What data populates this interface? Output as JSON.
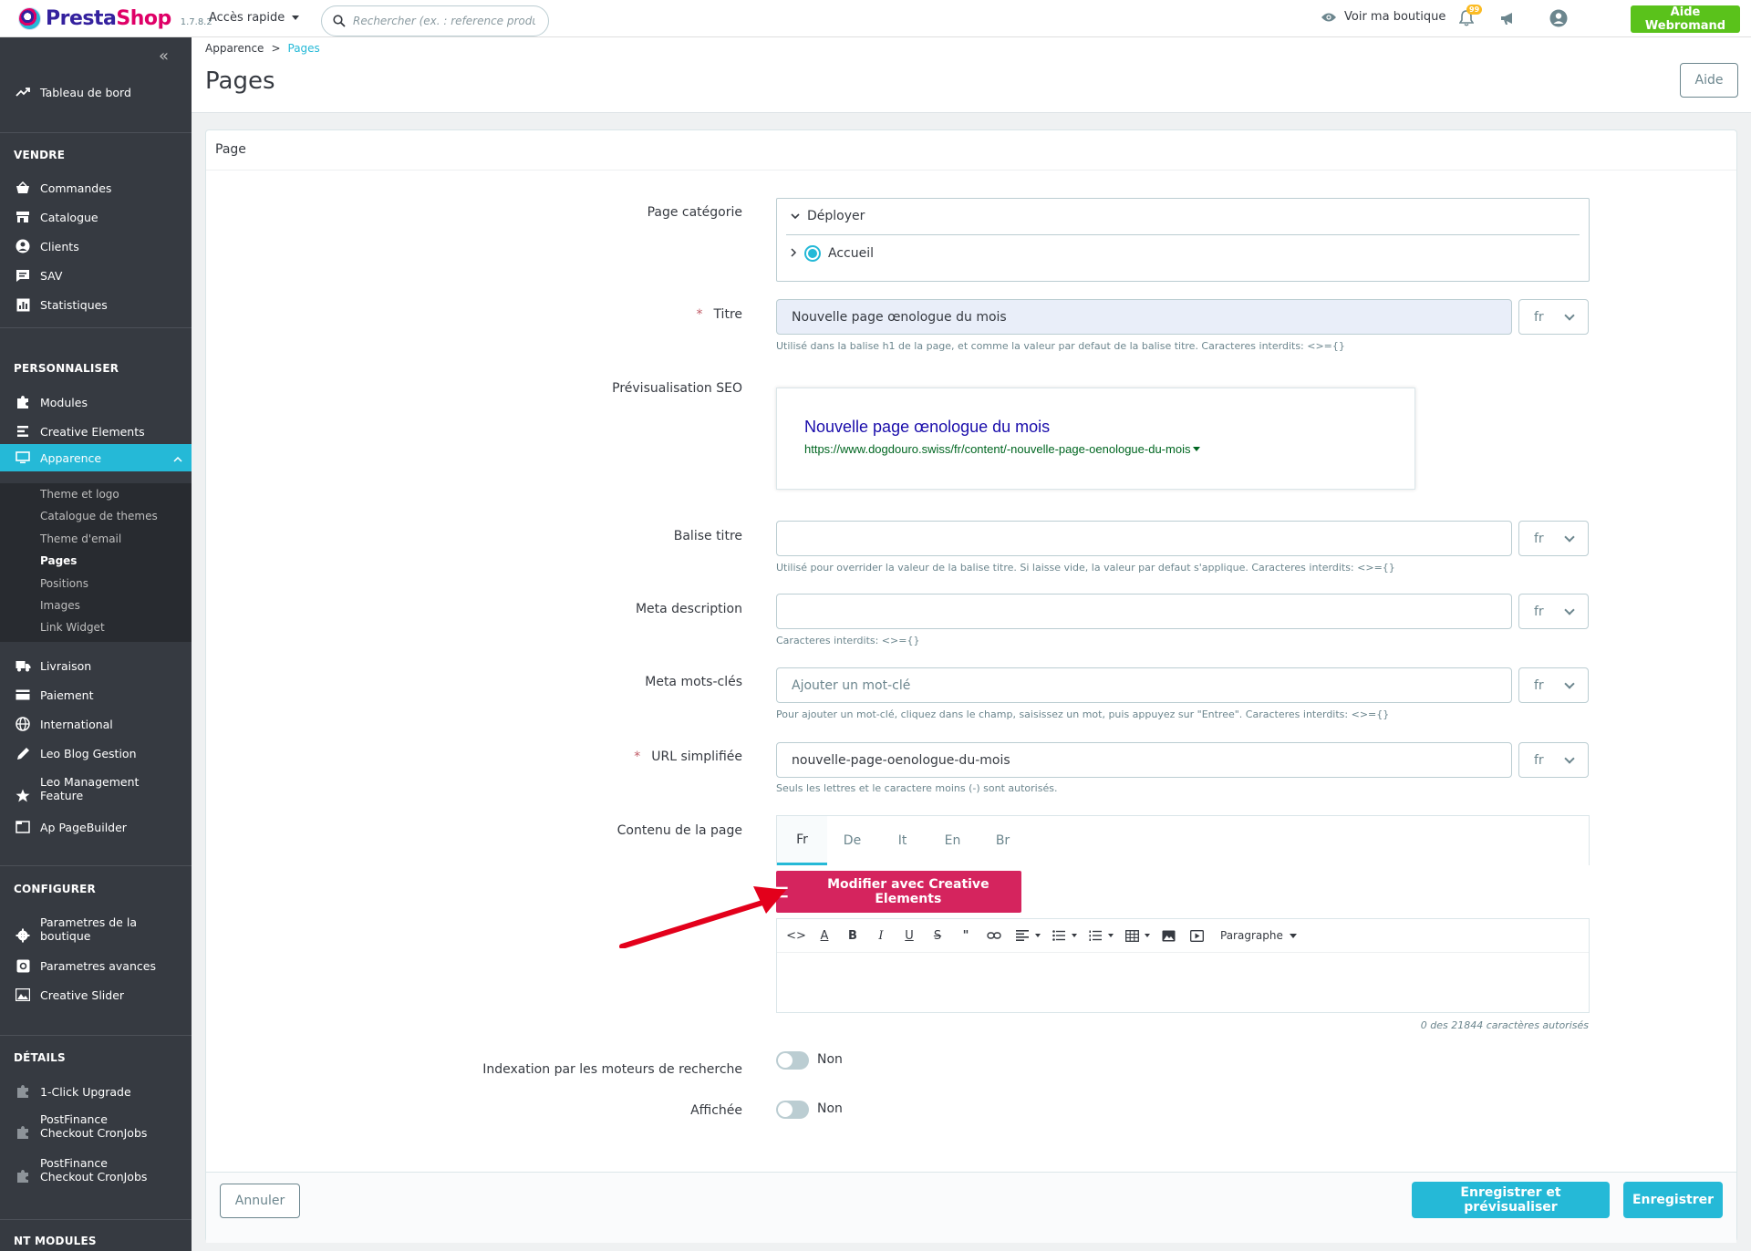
{
  "header": {
    "logo_text_a": "Presta",
    "logo_text_b": "Shop",
    "version": "1.7.8.2",
    "quick_access": "Accès rapide",
    "search_placeholder": "Rechercher (ex. : reference produit, no",
    "view_shop": "Voir ma boutique",
    "notifications_count": "99",
    "help_button": "Aide Webromand"
  },
  "sidebar": {
    "collapse_glyph": "«",
    "dashboard": "Tableau de bord",
    "sections": {
      "vendre": "VENDRE",
      "personnaliser": "PERSONNALISER",
      "configurer": "CONFIGURER",
      "details": "DÉTAILS",
      "nt_modules": "NT MODULES"
    },
    "vendre_items": [
      "Commandes",
      "Catalogue",
      "Clients",
      "SAV",
      "Statistiques"
    ],
    "personnaliser_items": [
      "Modules",
      "Creative Elements",
      "Apparence"
    ],
    "apparence_sub": [
      "Theme et logo",
      "Catalogue de themes",
      "Theme d'email",
      "Pages",
      "Positions",
      "Images",
      "Link Widget"
    ],
    "more_items": [
      "Livraison",
      "Paiement",
      "International",
      "Leo Blog Gestion",
      "Leo Management Feature",
      "Ap PageBuilder"
    ],
    "configurer_items": [
      "Parametres de la boutique",
      "Parametres avances",
      "Creative Slider"
    ],
    "details_items": [
      "1-Click Upgrade",
      "PostFinance Checkout CronJobs",
      "PostFinance Checkout CronJobs"
    ]
  },
  "page": {
    "breadcrumb_parent": "Apparence",
    "breadcrumb_sep": ">",
    "breadcrumb_current": "Pages",
    "title": "Pages",
    "aide": "Aide"
  },
  "form": {
    "panel_title": "Page",
    "category_label": "Page catégorie",
    "tree_expand": "Déployer",
    "tree_root": "Accueil",
    "titre_label": "Titre",
    "required_star": "*",
    "titre_value": "Nouvelle page œnologue du mois",
    "lang": "fr",
    "titre_hint": "Utilisé dans la balise h1 de la page, et comme la valeur par defaut de la balise titre. Caracteres interdits: <>={}",
    "seo_label": "Prévisualisation SEO",
    "seo_title": "Nouvelle page œnologue du mois",
    "seo_url": "https://www.dogdouro.swiss/fr/content/-nouvelle-page-oenologue-du-mois",
    "balise_label": "Balise titre",
    "balise_value": "",
    "balise_hint": "Utilisé pour overrider la valeur de la balise titre. Si laisse vide, la valeur par defaut s'applique. Caracteres interdits: <>={}",
    "meta_desc_label": "Meta description",
    "meta_desc_value": "",
    "meta_desc_hint": "Caracteres interdits: <>={}",
    "keywords_label": "Meta mots-clés",
    "keywords_placeholder": "Ajouter un mot-clé",
    "keywords_hint": "Pour ajouter un mot-clé, cliquez dans le champ, saisissez un mot, puis appuyez sur \"Entree\". Caracteres interdits: <>={}",
    "url_label": "URL simplifiée",
    "url_value": "nouvelle-page-oenologue-du-mois",
    "url_hint": "Seuls les lettres et le caractere moins (-) sont autorisés.",
    "content_label": "Contenu de la page",
    "content_tabs": [
      "Fr",
      "De",
      "It",
      "En",
      "Br"
    ],
    "ce_button": "Modifier avec Creative Elements",
    "paragraph": "Paragraphe",
    "counter": "0 des 21844 caractères autorisés",
    "indexation_label": "Indexation par les moteurs de recherche",
    "indexation_value": "Non",
    "affichee_label": "Affichée",
    "affichee_value": "Non",
    "cancel": "Annuler",
    "save_preview": "Enregistrer et prévisualiser",
    "save": "Enregistrer"
  },
  "colors": {
    "accent": "#25b9d7",
    "sidebar_bg": "#363a41",
    "ce_button": "#d5245e",
    "arrow": "#e3001b",
    "help_button": "#5ac21b"
  }
}
